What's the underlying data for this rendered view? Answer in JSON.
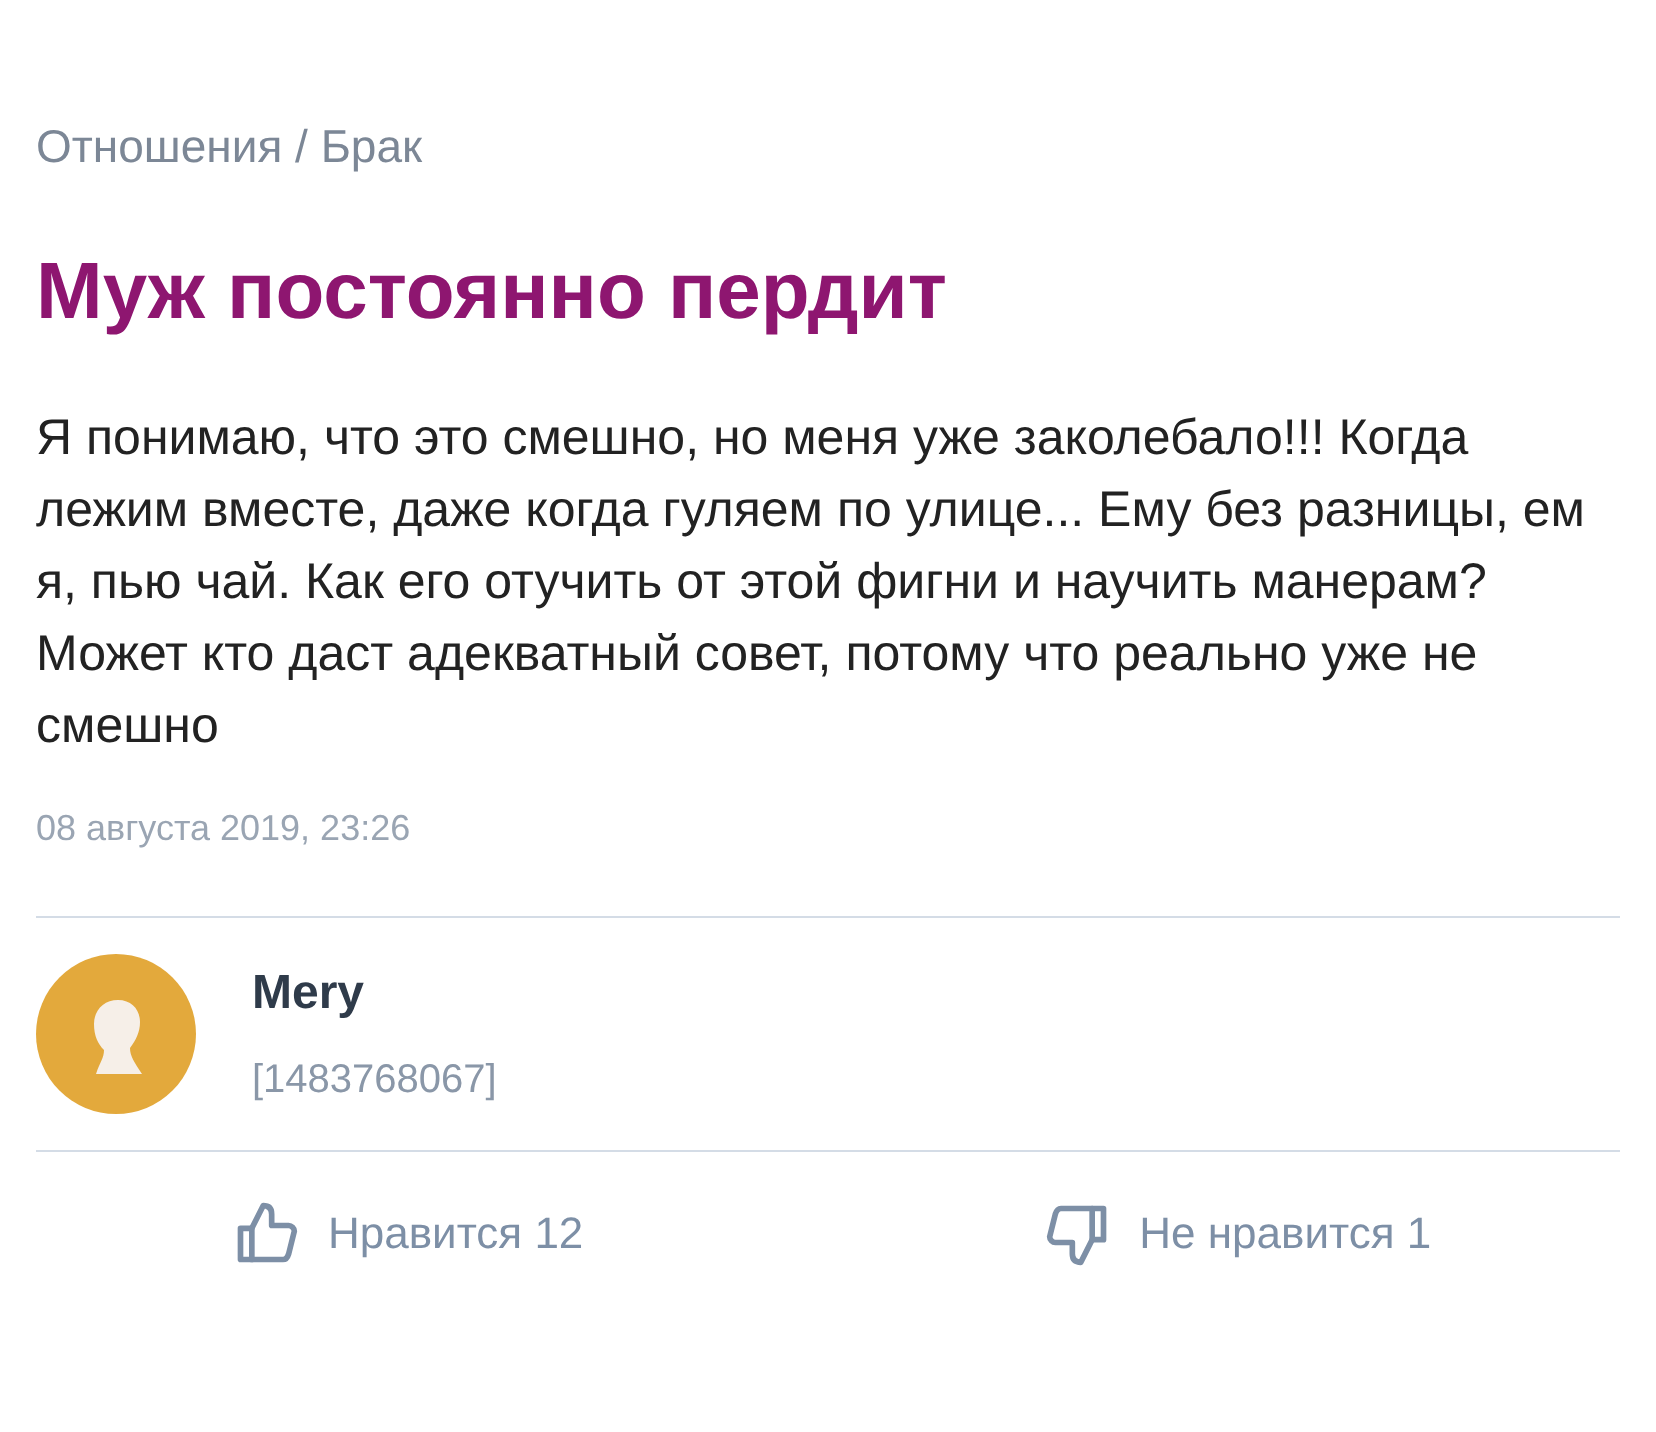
{
  "breadcrumb": "Отношения / Брак",
  "title": "Муж постоянно пердит",
  "body": "Я понимаю, что это смешно, но меня уже заколебало!!! Когда лежим вместе, даже когда гуляем по улице... Ему без разницы, ем я, пью чай. Как его отучить от этой фигни и научить манерам? Может кто даст адекватный совет, потому что реально уже не смешно",
  "date": "08 августа 2019, 23:26",
  "author": {
    "name": "Mery",
    "id": "[1483768067]"
  },
  "reactions": [
    {
      "kind": "like",
      "label": "Нравится 12"
    },
    {
      "kind": "dislike",
      "label": "Не нравится 1"
    }
  ]
}
